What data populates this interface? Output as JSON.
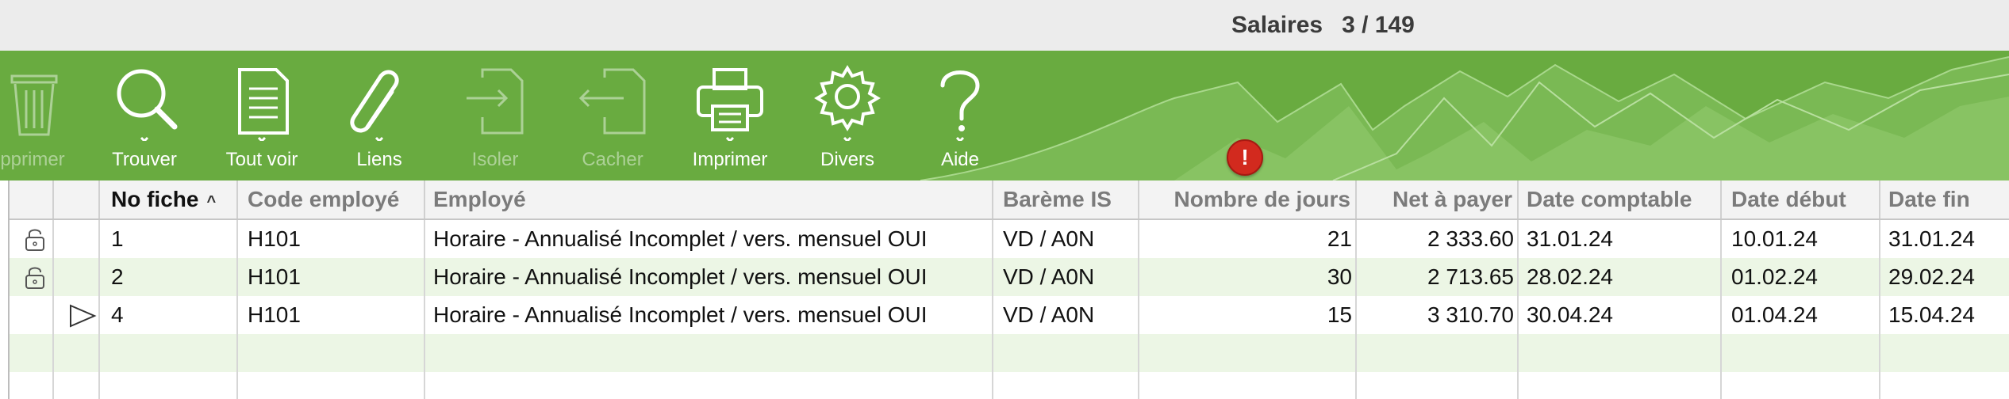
{
  "window": {
    "title": "Salaires",
    "record_counter": "3 / 149"
  },
  "toolbar": {
    "buttons": [
      {
        "id": "supprimer",
        "label": "pprimer",
        "icon": "trash-icon",
        "enabled": false
      },
      {
        "id": "trouver",
        "label": "Trouver",
        "icon": "magnifier-icon",
        "enabled": true
      },
      {
        "id": "tout_voir",
        "label": "Tout voir",
        "icon": "document-list-icon",
        "enabled": true
      },
      {
        "id": "liens",
        "label": "Liens",
        "icon": "paperclip-icon",
        "enabled": true
      },
      {
        "id": "isoler",
        "label": "Isoler",
        "icon": "document-arrow-in-icon",
        "enabled": false
      },
      {
        "id": "cacher",
        "label": "Cacher",
        "icon": "document-arrow-out-icon",
        "enabled": false
      },
      {
        "id": "imprimer",
        "label": "Imprimer",
        "icon": "printer-icon",
        "enabled": true
      },
      {
        "id": "divers",
        "label": "Divers",
        "icon": "gear-icon",
        "enabled": true
      },
      {
        "id": "aide",
        "label": "Aide",
        "icon": "question-mark-icon",
        "enabled": true
      }
    ],
    "warning_badge": "!"
  },
  "colors": {
    "toolbar_green": "#69ab40",
    "row_alt": "#ecf6e5",
    "warning_red": "#d22a1e"
  },
  "table": {
    "columns": [
      "No fiche",
      "Code employé",
      "Employé",
      "Barème IS",
      "Nombre de jours",
      "Net à payer",
      "Date comptable",
      "Date début",
      "Date fin"
    ],
    "sort_indicator": "^",
    "rows": [
      {
        "status_icon": "lock-icon",
        "no_fiche": "1",
        "code": "H101",
        "employe": "Horaire - Annualisé Incomplet / vers. mensuel OUI",
        "bareme": "VD / A0N",
        "jours": "21",
        "net": "2 333.60",
        "date_comptable": "31.01.24",
        "date_debut": "10.01.24",
        "date_fin": "31.01.24"
      },
      {
        "status_icon": "lock-icon",
        "no_fiche": "2",
        "code": "H101",
        "employe": "Horaire - Annualisé Incomplet / vers. mensuel OUI",
        "bareme": "VD / A0N",
        "jours": "30",
        "net": "2 713.65",
        "date_comptable": "28.02.24",
        "date_debut": "01.02.24",
        "date_fin": "29.02.24"
      },
      {
        "status_icon": "current-row-icon",
        "no_fiche": "4",
        "code": "H101",
        "employe": "Horaire - Annualisé Incomplet / vers. mensuel OUI",
        "bareme": "VD / A0N",
        "jours": "15",
        "net": "3 310.70",
        "date_comptable": "30.04.24",
        "date_debut": "01.04.24",
        "date_fin": "15.04.24"
      }
    ]
  }
}
